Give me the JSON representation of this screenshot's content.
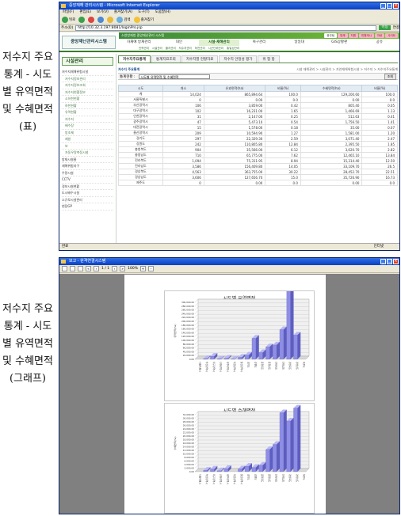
{
  "captions": {
    "table_caption": "저수지 주요통계 - 시도별 유역면적 및 수혜면적(표)",
    "graph_caption": "저수지 주요통계 - 시도별 유역면적 및 수혜면적 (그래프)"
  },
  "browser": {
    "title": "중앙재해 관리시스템 - Microsoft Internet Explorer",
    "menu": [
      "파일(F)",
      "편집(E)",
      "보기(V)",
      "즐겨찾기(A)",
      "도구(T)",
      "도움말(H)"
    ],
    "back_label": "뒤로",
    "search_label": "검색",
    "favorites_label": "즐겨찾기",
    "address_label": "주소(D)",
    "address_value": "http://10.32.3.197:8081/loginPro.jsp",
    "go_label": "이동",
    "links_label": "연결",
    "status_left": "완료",
    "status_right": "인터넷"
  },
  "app": {
    "logo": "중앙재난관리시스템",
    "top_strip": "소방방재청 중앙재난관리 시스템",
    "util_tabs": [
      "종무팀",
      "방재",
      "지원",
      "민원게시",
      "자료",
      "사이트"
    ],
    "main_nav": [
      "자재예 방재관리",
      "대인",
      "시설·재해관리",
      "복구관리",
      "일일대",
      "GIS상황판",
      "공유"
    ],
    "sub_nav": [
      "인력관리",
      "시설관리",
      "물자관리",
      "저수지관리",
      "하천관리",
      "시군단위관리",
      "통일성관리"
    ]
  },
  "sidebar": {
    "title": "시설관리",
    "items": [
      {
        "label": "저수지재해위험시설",
        "type": "head"
      },
      {
        "label": "저수지정보관리",
        "type": "sub"
      },
      {
        "label": "저수지정보조회",
        "type": "sub"
      },
      {
        "label": "저수지현황정보",
        "type": "sub"
      },
      {
        "label": "소하천현황",
        "type": "sub"
      },
      {
        "label": "하천현황",
        "type": "sub"
      },
      {
        "label": "유역현황",
        "type": "sub"
      },
      {
        "label": "저수지",
        "type": "sub"
      },
      {
        "label": "배수장",
        "type": "sub"
      },
      {
        "label": "방조제",
        "type": "sub"
      },
      {
        "label": "제방",
        "type": "sub"
      },
      {
        "label": "보",
        "type": "sub"
      },
      {
        "label": "자동우량측정시설",
        "type": "sub"
      },
      {
        "label": "방재시설물",
        "type": "head"
      },
      {
        "label": "재해위험지구",
        "type": "head"
      },
      {
        "label": "우량시설",
        "type": "head"
      },
      {
        "label": "CCTV",
        "type": "head"
      },
      {
        "label": "경보시설현황",
        "type": "head"
      },
      {
        "label": "도시배수시설",
        "type": "head"
      },
      {
        "label": "소규모시설관리",
        "type": "head"
      },
      {
        "label": "현장GP",
        "type": "head"
      }
    ]
  },
  "content": {
    "tabs": [
      "저수지주요통계",
      "통계지표조회",
      "저수지별 현황자료",
      "저수지 안정성 평가",
      "위 험 항"
    ],
    "section_title": "저수지 주요통계",
    "breadcrumb": "시설 재해관리 > 시설관리 > 자연재해위험시설 > 저수지 > 저수지주요통계",
    "filter_label": "통계현황 :",
    "filter_value": "시도별 유역면적 및 수혜면적",
    "search_button": "조회",
    "columns": [
      "시도",
      "개소",
      "유효면적(ha)",
      "비율(%)",
      "수혜면적(ha)",
      "비율(%)"
    ],
    "rows": [
      [
        "계",
        "14,024",
        "865,894.64",
        "100.0",
        "129,200.60",
        "100.0"
      ],
      [
        "서울특별시",
        "0",
        "0.00",
        "0.0",
        "0.00",
        "0.0"
      ],
      [
        "부산광역시",
        "106",
        "3,859.00",
        "0.42",
        "805.40",
        "0.05"
      ],
      [
        "대구광역시",
        "102",
        "16,231.00",
        "1.65",
        "1,466.69",
        "1.13"
      ],
      [
        "인천광역시",
        "31",
        "2,147.00",
        "0.25",
        "512.63",
        "0.41"
      ],
      [
        "광주광역시",
        "47",
        "5,473.10",
        "0.54",
        "1,756.50",
        "1.41"
      ],
      [
        "대전광역시",
        "15",
        "1,578.00",
        "0.18",
        "35.00",
        "0.07"
      ],
      [
        "울산광역시",
        "209",
        "10,594.90",
        "1.27",
        "1,581.00",
        "1.20"
      ],
      [
        "경기도",
        "297",
        "22,329.30",
        "2.59",
        "3,071.40",
        "2.47"
      ],
      [
        "강원도",
        "242",
        "110,805.80",
        "12.84",
        "2,395.50",
        "1.85"
      ],
      [
        "충청북도",
        "904",
        "35,566.00",
        "6.12",
        "3,620.70",
        "2.82"
      ],
      [
        "충청남도",
        "710",
        "65,775.00",
        "7.62",
        "12,465.10",
        "13.84"
      ],
      [
        "전라북도",
        "1,094",
        "75,311.95",
        "8.94",
        "15,314.40",
        "12.50"
      ],
      [
        "전라남도",
        "3,586",
        "156,409.80",
        "14.05",
        "33,109.70",
        "26.5"
      ],
      [
        "경상북도",
        "4,563",
        "363,755.00",
        "30.22",
        "28,452.70",
        "22.51"
      ],
      [
        "경상남도",
        "3,606",
        "127,656.70",
        "15.0",
        "35,726.90",
        "16.73"
      ],
      [
        "제주도",
        "0",
        "0.00",
        "0.0",
        "0.00",
        "0.0"
      ]
    ]
  },
  "report_viewer": {
    "title": "보고 - 원격연결시스템",
    "zoom": "100%",
    "page_nav": "1 / 1"
  },
  "chart_data": [
    {
      "type": "bar",
      "title": "시도별 유역면적",
      "ylabel": "유역면적(ha)",
      "categories": [
        "서울특별시",
        "부산광역시",
        "대구광역시",
        "인천광역시",
        "광주광역시",
        "대전광역시",
        "울산광역시",
        "경기도",
        "강원도",
        "충청북도",
        "충청남도",
        "전라북도",
        "전라남도",
        "경상북도",
        "경상남도",
        "제주도"
      ],
      "values": [
        0,
        3859,
        16231,
        2147,
        5473,
        1578,
        10595,
        22329,
        110806,
        35566,
        65775,
        75312,
        156410,
        363755,
        127657,
        0
      ],
      "ylim": [
        0,
        300000
      ],
      "yticks": [
        "0.00",
        "20,000.00",
        "40,000.00",
        "60,000.00",
        "80,000.00",
        "100,000.00",
        "120,000.00",
        "140,000.00",
        "160,000.00",
        "180,000.00",
        "200,000.00",
        "220,000.00",
        "240,000.00",
        "260,000.00",
        "280,000.00",
        "300,000.00"
      ],
      "bar_color": "#8e8ee6"
    },
    {
      "type": "bar",
      "title": "시도별 수혜면적",
      "ylabel": "수혜면적(ha)",
      "categories": [
        "서울특별시",
        "부산광역시",
        "대구광역시",
        "인천광역시",
        "광주광역시",
        "대전광역시",
        "울산광역시",
        "경기도",
        "강원도",
        "충청북도",
        "충청남도",
        "전라북도",
        "전라남도",
        "경상북도",
        "경상남도",
        "제주도"
      ],
      "values": [
        0,
        805,
        1467,
        513,
        1757,
        35,
        1581,
        3071,
        2396,
        3621,
        12465,
        15314,
        33110,
        28453,
        35727,
        0
      ],
      "ylim": [
        0,
        32000
      ],
      "yticks": [
        "0.00",
        "2,000.00",
        "4,000.00",
        "6,000.00",
        "8,000.00",
        "10,000.00",
        "12,000.00",
        "14,000.00",
        "16,000.00",
        "18,000.00",
        "20,000.00",
        "22,000.00",
        "24,000.00",
        "26,000.00",
        "28,000.00",
        "30,000.00",
        "32,000.00"
      ],
      "bar_color": "#8e8ee6"
    }
  ]
}
